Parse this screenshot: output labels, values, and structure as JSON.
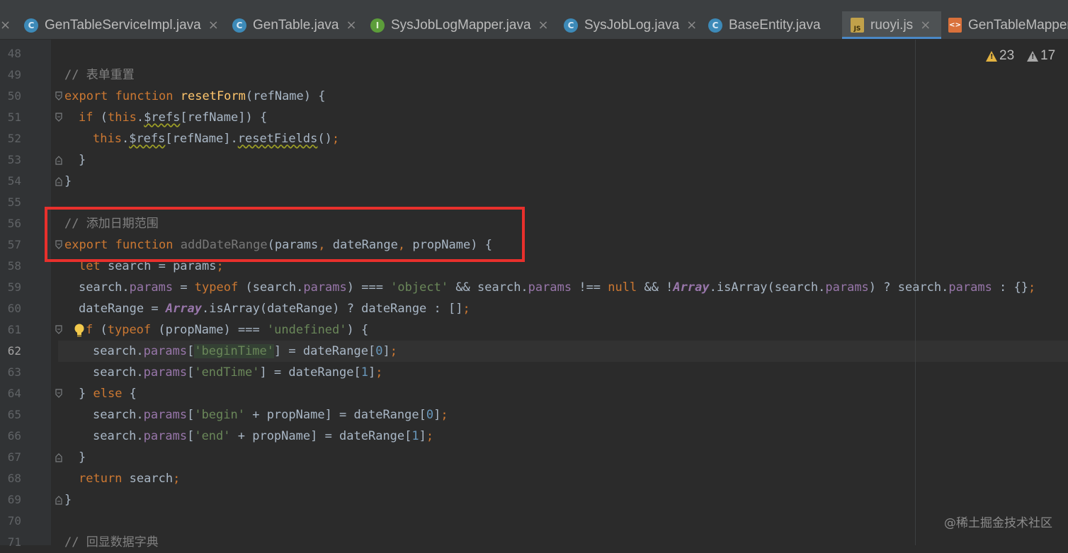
{
  "tabs": [
    {
      "label": "GenTableServiceImpl.java",
      "icon": "class-icon",
      "active": false
    },
    {
      "label": "GenTable.java",
      "icon": "class-icon",
      "active": false
    },
    {
      "label": "SysJobLogMapper.java",
      "icon": "interface-icon",
      "active": false
    },
    {
      "label": "SysJobLog.java",
      "icon": "class-icon",
      "active": false
    },
    {
      "label": "BaseEntity.java",
      "icon": "class-icon",
      "active": false
    },
    {
      "label": "ruoyi.js",
      "icon": "js-file-icon",
      "active": true
    },
    {
      "label": "GenTableMapper",
      "icon": "xml-file-icon",
      "active": false
    }
  ],
  "inspections": {
    "warnings": "23",
    "weak_warnings": "17"
  },
  "editor": {
    "current_line": "62",
    "line_numbers": [
      "48",
      "49",
      "50",
      "51",
      "52",
      "53",
      "54",
      "55",
      "56",
      "57",
      "58",
      "59",
      "60",
      "61",
      "62",
      "63",
      "64",
      "65",
      "66",
      "67",
      "68",
      "69",
      "70",
      "71"
    ]
  },
  "code": {
    "l49": "// 表单重置",
    "l50_kw": "export function ",
    "l50_fn": "resetForm",
    "l50_rest": "(refName) {",
    "l51_kw": "if",
    "l51_a": " (",
    "l51_this": "this",
    "l51_dot": ".",
    "l51_refs": "$refs",
    "l51_b": "[refName]) {",
    "l52_this": "this",
    "l52_dot": ".",
    "l52_refs": "$refs",
    "l52_a": "[refName].",
    "l52_m": "resetFields",
    "l52_b": "()",
    "l52_semi": ";",
    "l53": "}",
    "l54": "}",
    "l56": "// 添加日期范围",
    "l57_kw": "export function ",
    "l57_fn": "addDateRange",
    "l57_a": "(params",
    "l57_c1": ",",
    "l57_b": " dateRange",
    "l57_c2": ",",
    "l57_d": " propName) {",
    "l58_kw": "let",
    "l58_rest": " search = params",
    "l58_semi": ";",
    "l59_a": "search.",
    "l59_p1": "params",
    "l59_b": " = ",
    "l59_kw1": "typeof",
    "l59_c": " (search.",
    "l59_p2": "params",
    "l59_d": ") === ",
    "l59_s": "'object'",
    "l59_e": " && search.",
    "l59_p3": "params",
    "l59_f": " !== ",
    "l59_kw2": "null",
    "l59_g": " && !",
    "l59_arr": "Array",
    "l59_h": ".isArray(search.",
    "l59_p4": "params",
    "l59_i": ") ? search.",
    "l59_p5": "params",
    "l59_j": " : {}",
    "l59_semi": ";",
    "l60_a": "dateRange = ",
    "l60_arr": "Array",
    "l60_b": ".isArray(dateRange) ? dateRange : []",
    "l60_semi": ";",
    "l61_kw1": "f",
    "l61_a": " (",
    "l61_kw2": "typeof",
    "l61_b": " (propName) === ",
    "l61_s": "'undefined'",
    "l61_c": ") {",
    "l62_a": "search.",
    "l62_p": "params",
    "l62_b": "[",
    "l62_s": "'beginTime'",
    "l62_c": "] = dateRange[",
    "l62_n": "0",
    "l62_d": "]",
    "l62_semi": ";",
    "l63_a": "search.",
    "l63_p": "params",
    "l63_b": "[",
    "l63_s": "'endTime'",
    "l63_c": "] = dateRange[",
    "l63_n": "1",
    "l63_d": "]",
    "l63_semi": ";",
    "l64_a": "} ",
    "l64_kw": "else",
    "l64_b": " {",
    "l65_a": "search.",
    "l65_p": "params",
    "l65_b": "[",
    "l65_s": "'begin'",
    "l65_c": " + propName] = dateRange[",
    "l65_n": "0",
    "l65_d": "]",
    "l65_semi": ";",
    "l66_a": "search.",
    "l66_p": "params",
    "l66_b": "[",
    "l66_s": "'end'",
    "l66_c": " + propName] = dateRange[",
    "l66_n": "1",
    "l66_d": "]",
    "l66_semi": ";",
    "l67": "}",
    "l68_kw": "return",
    "l68_rest": " search",
    "l68_semi": ";",
    "l69": "}",
    "l71": "// 回显数据字典"
  },
  "watermark": "@稀土掘金技术社区",
  "colors": {
    "keyword": "#cc7832",
    "string": "#6a8759",
    "number": "#6897bb",
    "property": "#9876aa",
    "function": "#ffc66d",
    "comment": "#808080",
    "highlight_box": "#e8302c",
    "active_tab_underline": "#4a88c7"
  }
}
